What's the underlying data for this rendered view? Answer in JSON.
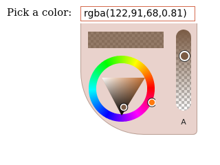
{
  "form": {
    "label": "Pick a color:",
    "value": "rgba(122,91,68,0.81)"
  },
  "picker": {
    "alpha_label": "A",
    "alpha_value": 0.81,
    "current_color": "#7a5b44",
    "focus_border_color": "#d46a4e",
    "panel_background": "#e9d2cc"
  }
}
